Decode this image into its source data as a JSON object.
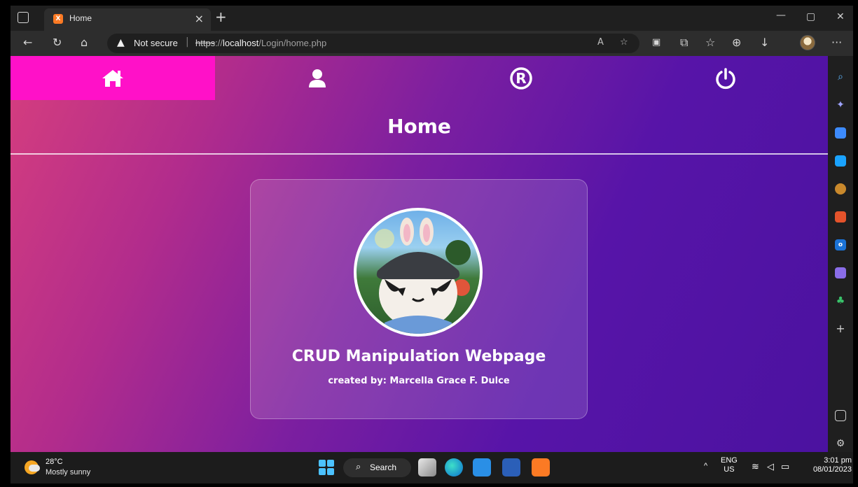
{
  "browser": {
    "tab_title": "Home",
    "tab_favicon_text": "X",
    "new_tab_symbol": "+",
    "close_tab_symbol": "×",
    "security_label": "Not secure",
    "url_protocol": "https",
    "url_host": "localhost",
    "url_path": "/Login/home.php",
    "icons": [
      "tab-actions-icon",
      "back-icon",
      "refresh-icon",
      "home-icon",
      "warning-icon",
      "read-aloud-icon",
      "favorites-add-icon",
      "notion-icon",
      "extensions-icon",
      "favorites-icon",
      "collections-icon",
      "download-icon",
      "profile-icon",
      "more-icon",
      "minimize-icon",
      "maximize-icon",
      "close-window-icon"
    ]
  },
  "sidebar": {
    "icons": [
      "search-icon",
      "copilot-icon",
      "shopping-icon",
      "tools-icon",
      "games-icon",
      "office-icon",
      "outlook-icon",
      "drop-icon",
      "tree-icon",
      "add-icon",
      "split-screen-icon",
      "settings-icon"
    ]
  },
  "nav": {
    "items": [
      {
        "name": "home",
        "icon": "home-icon",
        "active": true
      },
      {
        "name": "profile",
        "icon": "user-icon",
        "active": false
      },
      {
        "name": "register",
        "icon": "registered-icon",
        "active": false
      },
      {
        "name": "logout",
        "icon": "power-icon",
        "active": false
      }
    ]
  },
  "header": {
    "title": "Home"
  },
  "card": {
    "title": "CRUD Manipulation Webpage",
    "byline": "created by: Marcella Grace F. Dulce"
  },
  "taskbar": {
    "temperature": "28°C",
    "weather": "Mostly sunny",
    "search_label": "Search",
    "lang_top": "ENG",
    "lang_bottom": "US",
    "time": "3:01 pm",
    "date": "08/01/2023"
  },
  "colors": {
    "nav_active": "#ff11c8",
    "gradient_start": "#d63e7e",
    "gradient_end": "#4b12a0"
  }
}
